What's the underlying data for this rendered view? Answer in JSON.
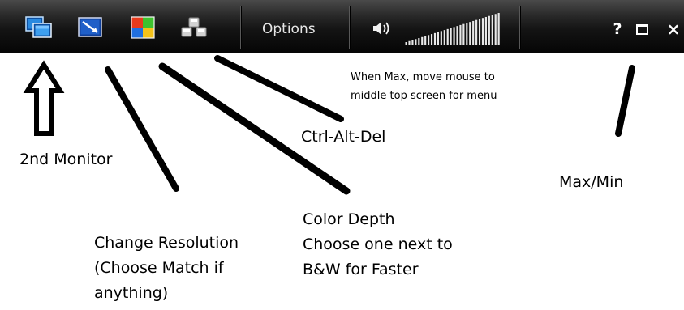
{
  "toolbar": {
    "buttons": [
      {
        "id": "monitor",
        "icon": "dual-monitor-icon",
        "description": "2nd Monitor"
      },
      {
        "id": "resolution",
        "icon": "resolution-icon",
        "description": "Change Resolution"
      },
      {
        "id": "color",
        "icon": "color-depth-icon",
        "description": "Color Depth"
      },
      {
        "id": "cad",
        "icon": "ctrl-alt-del-icon",
        "description": "Ctrl-Alt-Del"
      }
    ],
    "options_label": "Options",
    "volume_icon": "speaker-icon",
    "volume_level": 1.0,
    "help_label": "?",
    "close_label": "×"
  },
  "annotations": {
    "second_monitor": "2nd Monitor",
    "change_resolution": [
      "Change Resolution",
      "(Choose Match if",
      "anything)"
    ],
    "color_depth": [
      "Color Depth",
      "Choose one next to",
      "B&W for Faster"
    ],
    "ctrl_alt_del": "Ctrl-Alt-Del",
    "max_menu": [
      "When Max, move mouse to",
      "middle top screen for menu"
    ],
    "max_min": "Max/Min"
  },
  "colors": {
    "toolbar_bg": "#0a0a0a",
    "toolbar_text": "#e6e6e6",
    "icon_blue": "#1a78d6",
    "annotation_ink": "#000000"
  }
}
